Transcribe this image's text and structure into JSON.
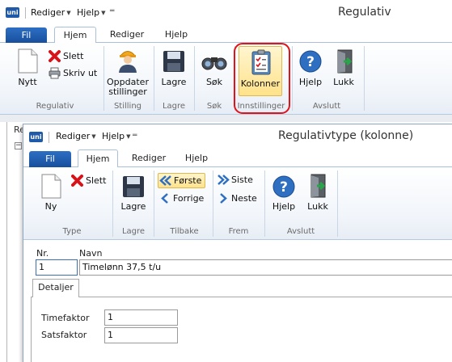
{
  "outer": {
    "menus": [
      "Rediger",
      "Hjelp"
    ],
    "title": "Regulativ",
    "tabs": {
      "fil": "Fil",
      "hjem": "Hjem",
      "rediger": "Rediger",
      "hjelp": "Hjelp"
    },
    "ribbon": {
      "nytt": "Nytt",
      "slett": "Slett",
      "skriv_ut": "Skriv ut",
      "oppdater": "Oppdater",
      "stillinger": "stillinger",
      "lagre": "Lagre",
      "sok": "Søk",
      "kolonner": "Kolonner",
      "hjelp": "Hjelp",
      "lukk": "Lukk",
      "groups": {
        "regulativ": "Regulativ",
        "stilling": "Stilling",
        "lagre": "Lagre",
        "sok": "Søk",
        "innstillinger": "Innstillinger",
        "avslutt": "Avslutt"
      }
    },
    "tree_fragment": "Re"
  },
  "inner": {
    "menus": [
      "Rediger",
      "Hjelp"
    ],
    "title": "Regulativtype (kolonne)",
    "tabs": {
      "fil": "Fil",
      "hjem": "Hjem",
      "rediger": "Rediger",
      "hjelp": "Hjelp"
    },
    "ribbon": {
      "ny": "Ny",
      "slett": "Slett",
      "lagre": "Lagre",
      "forste": "Første",
      "forrige": "Forrige",
      "siste": "Siste",
      "neste": "Neste",
      "hjelp": "Hjelp",
      "lukk": "Lukk",
      "groups": {
        "type": "Type",
        "lagre": "Lagre",
        "tilbake": "Tilbake",
        "frem": "Frem",
        "avslutt": "Avslutt"
      }
    },
    "form": {
      "nr_label": "Nr.",
      "nr_value": "1",
      "navn_label": "Navn",
      "navn_value": "Timelønn 37,5 t/u",
      "tab_detaljer": "Detaljer",
      "timefaktor_label": "Timefaktor",
      "timefaktor_value": "1",
      "satsfaktor_label": "Satsfaktor",
      "satsfaktor_value": "1"
    }
  },
  "colors": {
    "accent": "#1f5aa8",
    "highlight": "#ffe28a",
    "annotation": "#e0121a"
  }
}
